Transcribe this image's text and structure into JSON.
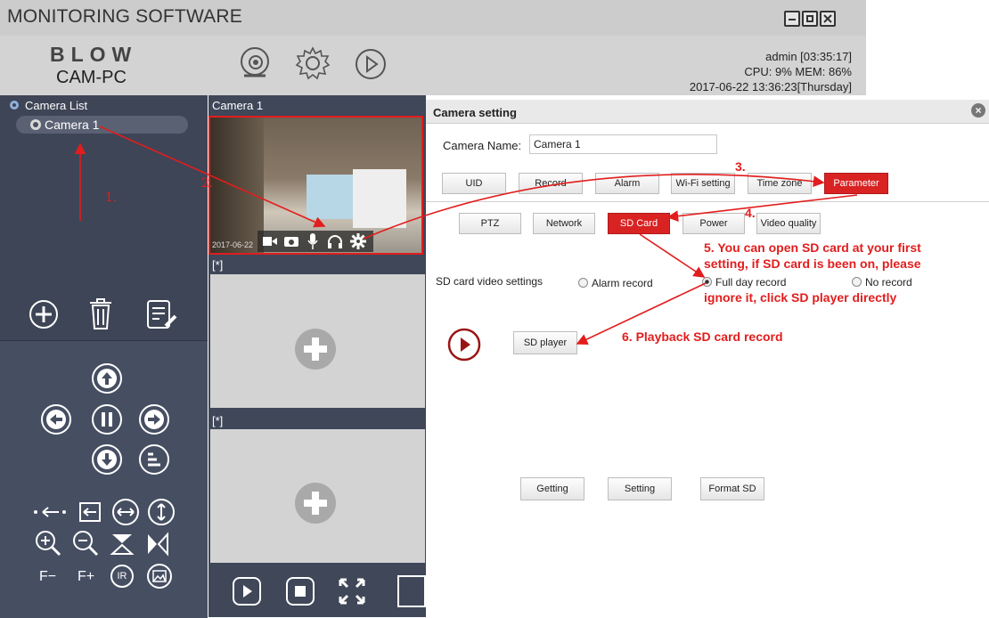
{
  "app": {
    "title": "MONITORING SOFTWARE",
    "brand": "BLOW",
    "model": "CAM-PC",
    "status": {
      "user_time": "admin  [03:35:17]",
      "cpu_mem": "CPU:  9%  MEM: 86%",
      "datetime": "2017-06-22 13:36:23[Thursday]"
    },
    "top_icons": [
      "webcam-icon",
      "gear-icon",
      "play-icon"
    ],
    "window_controls": [
      "minimize",
      "maximize",
      "close"
    ]
  },
  "sidebar": {
    "camera_list_label": "Camera List",
    "cameras": [
      "Camera 1"
    ],
    "actions": [
      "add-icon",
      "trash-icon",
      "edit-icon"
    ],
    "ptz_row_bottom": [
      "F−",
      "F+",
      "IR"
    ]
  },
  "views": {
    "cam1_title": "Camera 1",
    "cam1_timestamp": "2017-06-22",
    "slot2_title": "[*]",
    "slot3_title": "[*]"
  },
  "panel": {
    "title": "Camera setting",
    "camera_name_label": "Camera Name:",
    "camera_name_value": "Camera 1",
    "tabs_row1": [
      "UID",
      "Record",
      "Alarm",
      "Wi-Fi setting",
      "Time zone",
      "Parameter"
    ],
    "tabs_row2": [
      "PTZ",
      "Network",
      "SD Card",
      "Power",
      "Video quality"
    ],
    "active_row1": "Parameter",
    "active_row2": "SD Card",
    "sd_settings_label": "SD card video settings",
    "radio_options": [
      "Alarm record",
      "Full day record",
      "No record"
    ],
    "radio_selected": "Full day record",
    "sd_player_label": "SD player",
    "bottom_buttons": [
      "Getting",
      "Setting",
      "Format SD"
    ]
  },
  "annotations": {
    "n1": "1.",
    "n2": "2.",
    "n3": "3.",
    "n4": "4.",
    "n5_line1": "5. You can open SD card at your first",
    "n5_line2": "setting, if SD card is been on, please",
    "n5_line3": "ignore it, click SD player directly",
    "n6": "6. Playback SD card record"
  },
  "colors": {
    "accent_red": "#e21d1d",
    "sidebar_bg": "#3e4556",
    "titlebar_bg": "#cccccc"
  }
}
